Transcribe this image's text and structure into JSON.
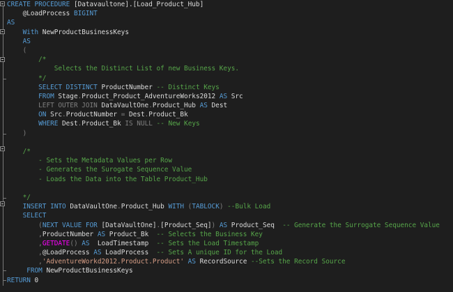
{
  "editor": {
    "language": "sql",
    "colors": {
      "background": "#1e1e1e",
      "keyword": "#569cd6",
      "text": "#dcdcdc",
      "comment": "#57a64a",
      "string": "#d69d85",
      "function": "#ff00ff",
      "grey_operator": "#808080"
    },
    "lines": [
      [
        [
          "k",
          "CREATE PROCEDURE "
        ],
        [
          "t",
          "[Datavaultone].[Load_Product_Hub]"
        ]
      ],
      [
        [
          "t",
          "    @LoadProcess "
        ],
        [
          "k",
          "BIGINT"
        ]
      ],
      [
        [
          "k",
          "AS"
        ]
      ],
      [
        [
          "t",
          "    "
        ],
        [
          "k",
          "With"
        ],
        [
          "t",
          " NewProductBusinessKeys"
        ]
      ],
      [
        [
          "t",
          "    "
        ],
        [
          "k",
          "AS"
        ]
      ],
      [
        [
          "t",
          "    "
        ],
        [
          "g",
          "("
        ]
      ],
      [
        [
          "t",
          "        "
        ],
        [
          "c",
          "/*"
        ]
      ],
      [
        [
          "c",
          "            Selects the Distinct List of new Business Keys."
        ]
      ],
      [
        [
          "t",
          "        "
        ],
        [
          "c",
          "*/"
        ]
      ],
      [
        [
          "t",
          "        "
        ],
        [
          "k",
          "SELECT DISTINCT"
        ],
        [
          "t",
          " ProductNumber "
        ],
        [
          "c",
          "-- Distinct Keys"
        ]
      ],
      [
        [
          "t",
          "        "
        ],
        [
          "k",
          "FROM"
        ],
        [
          "t",
          " Stage"
        ],
        [
          "g",
          "."
        ],
        [
          "t",
          "Product_Product_AdventureWorks2012 "
        ],
        [
          "k",
          "AS"
        ],
        [
          "t",
          " Src"
        ]
      ],
      [
        [
          "t",
          "        "
        ],
        [
          "g",
          "LEFT OUTER JOIN"
        ],
        [
          "t",
          " DataVaultOne"
        ],
        [
          "g",
          "."
        ],
        [
          "t",
          "Product_Hub "
        ],
        [
          "k",
          "AS"
        ],
        [
          "t",
          " Dest"
        ]
      ],
      [
        [
          "t",
          "        "
        ],
        [
          "k",
          "ON"
        ],
        [
          "t",
          " Src"
        ],
        [
          "g",
          "."
        ],
        [
          "t",
          "ProductNumber "
        ],
        [
          "g",
          "="
        ],
        [
          "t",
          " Dest"
        ],
        [
          "g",
          "."
        ],
        [
          "t",
          "Product_Bk"
        ]
      ],
      [
        [
          "t",
          "        "
        ],
        [
          "k",
          "WHERE"
        ],
        [
          "t",
          " Dest"
        ],
        [
          "g",
          "."
        ],
        [
          "t",
          "Product_Bk "
        ],
        [
          "g",
          "IS NULL"
        ],
        [
          "t",
          " "
        ],
        [
          "c",
          "-- New Keys"
        ]
      ],
      [
        [
          "t",
          "    "
        ],
        [
          "g",
          ")"
        ]
      ],
      [
        [
          "t",
          ""
        ]
      ],
      [
        [
          "t",
          "    "
        ],
        [
          "c",
          "/*"
        ]
      ],
      [
        [
          "c",
          "        - Sets the Metadata Values per Row"
        ]
      ],
      [
        [
          "c",
          "        - Generates the Surogate Sequence Value"
        ]
      ],
      [
        [
          "c",
          "        - Loads the Data into the Table Product_Hub"
        ]
      ],
      [
        [
          "c",
          ""
        ]
      ],
      [
        [
          "t",
          "    "
        ],
        [
          "c",
          "*/"
        ]
      ],
      [
        [
          "t",
          "    "
        ],
        [
          "k",
          "INSERT INTO"
        ],
        [
          "t",
          " DataVaultOne"
        ],
        [
          "g",
          "."
        ],
        [
          "t",
          "Product_Hub "
        ],
        [
          "k",
          "WITH"
        ],
        [
          "t",
          " "
        ],
        [
          "g",
          "("
        ],
        [
          "k",
          "TABLOCK"
        ],
        [
          "g",
          ")"
        ],
        [
          "t",
          " "
        ],
        [
          "c",
          "--Bulk Load"
        ]
      ],
      [
        [
          "t",
          "    "
        ],
        [
          "k",
          "SELECT"
        ]
      ],
      [
        [
          "t",
          "        "
        ],
        [
          "g",
          "("
        ],
        [
          "k",
          "NEXT VALUE FOR"
        ],
        [
          "t",
          " [DataVaultOne]"
        ],
        [
          "g",
          "."
        ],
        [
          "t",
          "[Product_Seq]"
        ],
        [
          "g",
          ")"
        ],
        [
          "t",
          " "
        ],
        [
          "k",
          "AS"
        ],
        [
          "t",
          " Product_Seq  "
        ],
        [
          "c",
          "-- Generate the Surrogate Sequence Value"
        ]
      ],
      [
        [
          "t",
          "        "
        ],
        [
          "g",
          ","
        ],
        [
          "t",
          "ProductNumber "
        ],
        [
          "k",
          "AS"
        ],
        [
          "t",
          " Product_Bk  "
        ],
        [
          "c",
          "-- Selects the Business Key"
        ]
      ],
      [
        [
          "t",
          "        "
        ],
        [
          "g",
          ","
        ],
        [
          "f",
          "GETDATE"
        ],
        [
          "g",
          "()"
        ],
        [
          "t",
          " "
        ],
        [
          "k",
          "AS"
        ],
        [
          "t",
          "  LoadTimestamp  "
        ],
        [
          "c",
          "-- Sets the Load Timestamp"
        ]
      ],
      [
        [
          "t",
          "        "
        ],
        [
          "g",
          ","
        ],
        [
          "t",
          "@LoadProcess "
        ],
        [
          "k",
          "AS"
        ],
        [
          "t",
          " LoadProcess  "
        ],
        [
          "c",
          "-- Sets A unique ID for the Load"
        ]
      ],
      [
        [
          "t",
          "        "
        ],
        [
          "g",
          ","
        ],
        [
          "s",
          "'AdventureWorkd2012.Product.Product'"
        ],
        [
          "t",
          " "
        ],
        [
          "k",
          "AS"
        ],
        [
          "t",
          " RecordSource "
        ],
        [
          "c",
          "--Sets the Record Source"
        ]
      ],
      [
        [
          "t",
          "     "
        ],
        [
          "k",
          "FROM"
        ],
        [
          "t",
          " NewProductBusinessKeys"
        ]
      ],
      [
        [
          "k",
          "RETURN"
        ],
        [
          "t",
          " 0"
        ]
      ]
    ]
  }
}
